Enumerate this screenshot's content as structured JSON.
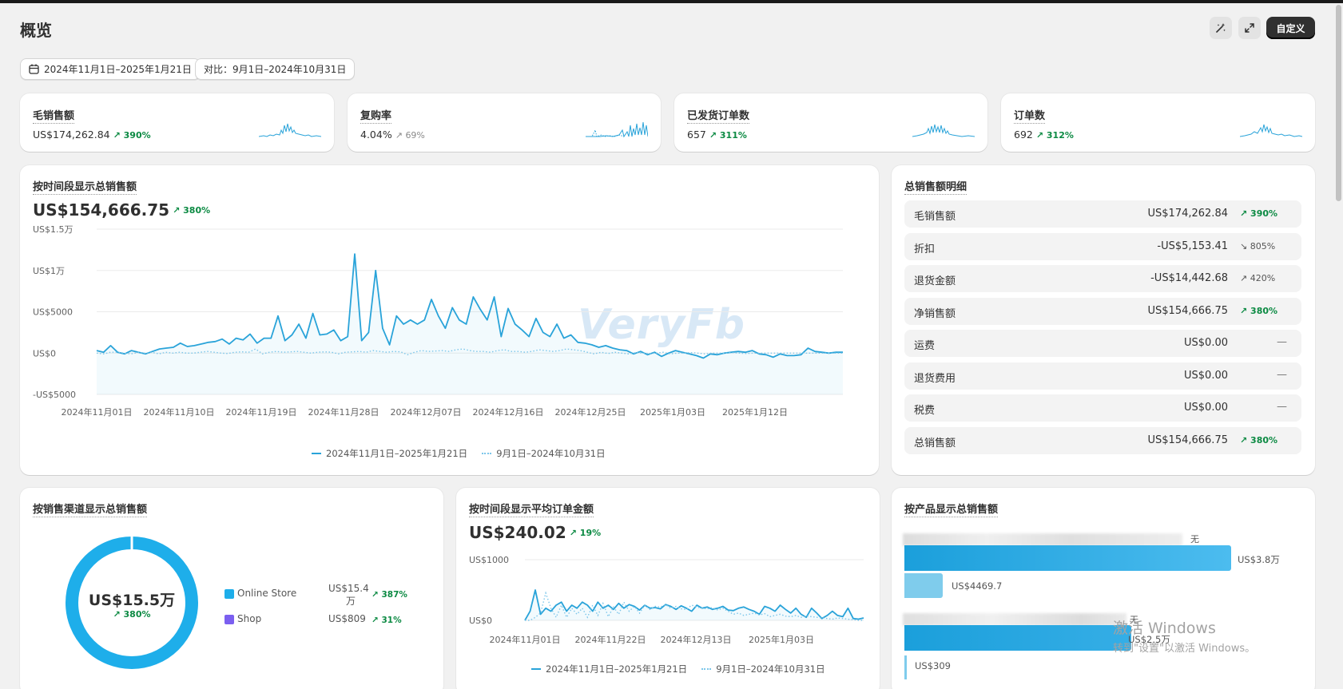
{
  "header": {
    "title": "概览",
    "icons": [
      "sparkle-edit-icon",
      "expand-icon"
    ],
    "custom_label": "自定义"
  },
  "filters": {
    "date_range": "2024年11月1日–2025年1月21日",
    "compare": "对比：9月1日–2024年10月31日"
  },
  "kpis": [
    {
      "title": "毛销售额",
      "value": "US$174,262.84",
      "delta": "390%",
      "trend": "up"
    },
    {
      "title": "复购率",
      "value": "4.04%",
      "delta": "69%",
      "trend": "up-neutral"
    },
    {
      "title": "已发货订单数",
      "value": "657",
      "delta": "311%",
      "trend": "up"
    },
    {
      "title": "订单数",
      "value": "692",
      "delta": "312%",
      "trend": "up"
    }
  ],
  "sales_over_time": {
    "title": "按时间段显示总销售额",
    "total": "US$154,666.75",
    "delta": "380%",
    "watermark": "VeryFb",
    "legend_current": "2024年11月1日–2025年1月21日",
    "legend_previous": "9月1日–2024年10月31日"
  },
  "breakdown": {
    "title": "总销售额明细",
    "rows": [
      {
        "label": "毛销售额",
        "value": "US$174,262.84",
        "delta": "390%",
        "trend": "up"
      },
      {
        "label": "折扣",
        "value": "-US$5,153.41",
        "delta": "805%",
        "trend": "down"
      },
      {
        "label": "退货金额",
        "value": "-US$14,442.68",
        "delta": "420%",
        "trend": "up-neutral"
      },
      {
        "label": "净销售额",
        "value": "US$154,666.75",
        "delta": "380%",
        "trend": "up"
      },
      {
        "label": "运费",
        "value": "US$0.00",
        "delta": "—",
        "trend": "none"
      },
      {
        "label": "退货费用",
        "value": "US$0.00",
        "delta": "—",
        "trend": "none"
      },
      {
        "label": "税费",
        "value": "US$0.00",
        "delta": "—",
        "trend": "none"
      },
      {
        "label": "总销售额",
        "value": "US$154,666.75",
        "delta": "380%",
        "trend": "up"
      }
    ]
  },
  "channel": {
    "title": "按销售渠道显示总销售额",
    "center_value": "US$15.5万",
    "center_delta": "380%",
    "colors": {
      "online": "#1eaeea",
      "shop": "#7b5ff0"
    },
    "items": [
      {
        "name": "Online Store",
        "value_line1": "US$15.4",
        "value_line2": "万",
        "delta": "387%"
      },
      {
        "name": "Shop",
        "value_line1": "US$809",
        "value_line2": "",
        "delta": "31%"
      }
    ]
  },
  "aov": {
    "title": "按时间段显示平均订单金额",
    "total": "US$240.02",
    "delta": "19%",
    "legend_current": "2024年11月1日–2025年1月21日",
    "legend_previous": "9月1日–2024年10月31日"
  },
  "product": {
    "title": "按产品显示总销售额",
    "rows": [
      {
        "tag": "无",
        "current_label": "US$3.8万",
        "previous_label": "US$4469.7"
      },
      {
        "tag": "无",
        "current_label": "US$2.5万",
        "previous_label": "US$309"
      }
    ]
  },
  "os_notice": {
    "line1": "激活 Windows",
    "line2": "转到\"设置\"以激活 Windows。"
  },
  "chart_data": [
    {
      "type": "line",
      "name": "sales_over_time",
      "title": "按时间段显示总销售额",
      "x_ticks": [
        "2024年11月01日",
        "2024年11月10日",
        "2024年11月19日",
        "2024年11月28日",
        "2024年12月07日",
        "2024年12月16日",
        "2024年12月25日",
        "2025年1月03日",
        "2025年1月12日"
      ],
      "y_ticks": [
        "US$1.5万",
        "US$1万",
        "US$5000",
        "US$0",
        "-US$5000"
      ],
      "ylim": [
        -5000,
        15000
      ],
      "grid": true,
      "series": [
        {
          "name": "2024年11月1日–2025年1月21日",
          "style": "solid",
          "values": [
            300,
            100,
            900,
            100,
            -100,
            300,
            100,
            -100,
            200,
            500,
            600,
            700,
            1200,
            800,
            900,
            1100,
            1300,
            1400,
            1700,
            1100,
            1800,
            1600,
            2300,
            1200,
            1800,
            1800,
            4500,
            1500,
            2200,
            3500,
            1800,
            4800,
            2200,
            2300,
            2800,
            1500,
            2000,
            12000,
            1500,
            2500,
            10000,
            3000,
            1000,
            4500,
            3500,
            4000,
            3500,
            4000,
            6500,
            4500,
            3000,
            5500,
            4000,
            3500,
            6800,
            5300,
            4000,
            6800,
            2000,
            5400,
            3500,
            2800,
            2000,
            4200,
            2500,
            2000,
            3500,
            1800,
            2200,
            1300,
            1200,
            1000,
            700,
            900,
            600,
            400,
            300,
            -100,
            200,
            -200,
            100,
            -400,
            0,
            300,
            100,
            -100,
            -300,
            -600,
            -100,
            -200,
            0,
            100,
            200,
            100,
            300,
            -100,
            -200,
            -500,
            -100,
            -300,
            -300,
            -200,
            600,
            200,
            100,
            0,
            100,
            100
          ]
        },
        {
          "name": "9月1日–2024年10月31日",
          "style": "dotted",
          "values": [
            0,
            -100,
            100,
            100,
            0,
            -100,
            100,
            0,
            100,
            -100,
            100,
            0,
            100,
            0,
            0,
            100,
            200,
            100,
            0,
            -50,
            100,
            150,
            100,
            500,
            -100,
            100,
            200,
            100,
            150,
            200,
            100,
            0,
            100,
            150,
            100,
            -100,
            100,
            150,
            200,
            100,
            300,
            200,
            100,
            200,
            150,
            -200,
            100,
            300,
            200,
            250,
            300,
            200,
            400,
            500,
            300,
            200,
            200,
            100,
            300,
            400,
            200,
            200,
            100,
            200,
            400,
            300,
            200,
            300,
            500,
            400,
            300,
            100,
            -100,
            100,
            -50,
            100,
            0,
            -100,
            50,
            0,
            -50,
            0,
            100,
            -100,
            0,
            0,
            50,
            0,
            -100,
            0,
            0,
            0,
            50,
            0,
            -50,
            0,
            0,
            0,
            0,
            0,
            0,
            0,
            0,
            0,
            0,
            0,
            0,
            0,
            0
          ]
        }
      ]
    },
    {
      "type": "line",
      "name": "avg_order_value",
      "title": "按时间段显示平均订单金额",
      "x_ticks": [
        "2024年11月01日",
        "2024年11月22日",
        "2024年12月13日",
        "2025年1月03日"
      ],
      "y_ticks": [
        "US$1000",
        "US$0"
      ],
      "ylim": [
        0,
        1000
      ],
      "grid": true,
      "series": [
        {
          "name": "2024年11月1日–2025年1月21日",
          "style": "solid",
          "values": [
            0,
            150,
            500,
            100,
            200,
            150,
            250,
            300,
            150,
            250,
            200,
            300,
            250,
            150,
            300,
            200,
            250,
            180,
            280,
            200,
            260,
            230,
            170,
            250,
            200,
            210,
            190,
            260,
            230,
            180,
            240,
            200,
            150,
            250,
            200,
            220,
            180,
            200,
            230,
            170,
            160,
            200,
            220,
            180,
            150,
            100,
            230,
            200,
            150,
            250,
            180,
            120,
            200,
            100,
            50,
            200,
            120,
            30,
            80,
            150,
            80,
            60,
            200,
            30,
            20,
            40
          ]
        },
        {
          "name": "9月1日–2024年10月31日",
          "style": "dotted",
          "values": [
            0,
            0,
            50,
            120,
            450,
            200,
            50,
            250,
            50,
            200,
            100,
            200,
            50,
            250,
            80,
            280,
            60,
            220,
            100,
            300,
            150,
            230,
            120,
            250,
            180,
            230,
            220,
            260,
            200,
            230,
            190,
            180,
            250,
            220,
            200,
            190,
            210,
            170,
            200,
            150,
            100,
            120,
            80,
            100,
            120,
            90,
            110,
            60,
            80,
            100,
            70,
            60,
            80,
            50,
            70,
            60,
            50,
            40,
            30,
            20,
            40,
            30,
            20,
            10,
            0,
            0
          ]
        }
      ]
    },
    {
      "type": "pie",
      "name": "sales_by_channel",
      "title": "按销售渠道显示总销售额",
      "slices": [
        {
          "name": "Online Store",
          "value": 154000
        },
        {
          "name": "Shop",
          "value": 809
        }
      ]
    },
    {
      "type": "bar",
      "name": "sales_by_product",
      "title": "按产品显示总销售额",
      "orientation": "horizontal",
      "categories": [
        "无",
        "无"
      ],
      "series": [
        {
          "name": "2024年11月1日–2025年1月21日",
          "values": [
            38000,
            25000
          ]
        },
        {
          "name": "9月1日–2024年10月31日",
          "values": [
            4469.7,
            309
          ]
        }
      ]
    }
  ]
}
